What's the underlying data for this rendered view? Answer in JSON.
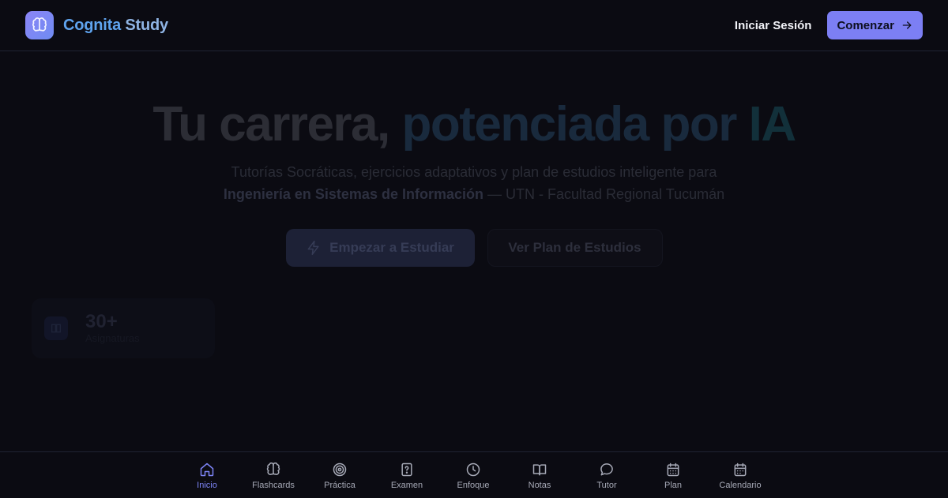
{
  "header": {
    "brand_part1": "Cognita",
    "brand_part2": "Study",
    "login_label": "Iniciar Sesión",
    "start_label": "Comenzar"
  },
  "hero": {
    "title_part1": "Tu carrera,",
    "title_part2": "potenciada por",
    "title_part3": "IA",
    "subtitle_line1": "Tutorías Socráticas, ejercicios adaptativos y plan de estudios inteligente para",
    "subtitle_bold": "Ingeniería en Sistemas de Información",
    "subtitle_rest": " — UTN - Facultad Regional Tucumán",
    "primary_cta": "Empezar a Estudiar",
    "secondary_cta": "Ver Plan de Estudios"
  },
  "stat": {
    "value": "30+",
    "label": "Asignaturas"
  },
  "nav": {
    "items": [
      {
        "label": "Inicio",
        "icon": "home-icon",
        "active": true
      },
      {
        "label": "Flashcards",
        "icon": "brain-icon",
        "active": false
      },
      {
        "label": "Práctica",
        "icon": "target-icon",
        "active": false
      },
      {
        "label": "Examen",
        "icon": "question-file-icon",
        "active": false
      },
      {
        "label": "Enfoque",
        "icon": "clock-icon",
        "active": false
      },
      {
        "label": "Notas",
        "icon": "book-icon",
        "active": false
      },
      {
        "label": "Tutor",
        "icon": "chat-icon",
        "active": false
      },
      {
        "label": "Plan",
        "icon": "calendar-grid-icon",
        "active": false
      },
      {
        "label": "Calendario",
        "icon": "calendar-icon",
        "active": false
      }
    ]
  },
  "colors": {
    "accent": "#7c7ff4",
    "background": "#0b0b12",
    "brand_blue": "#5fa3ee"
  }
}
